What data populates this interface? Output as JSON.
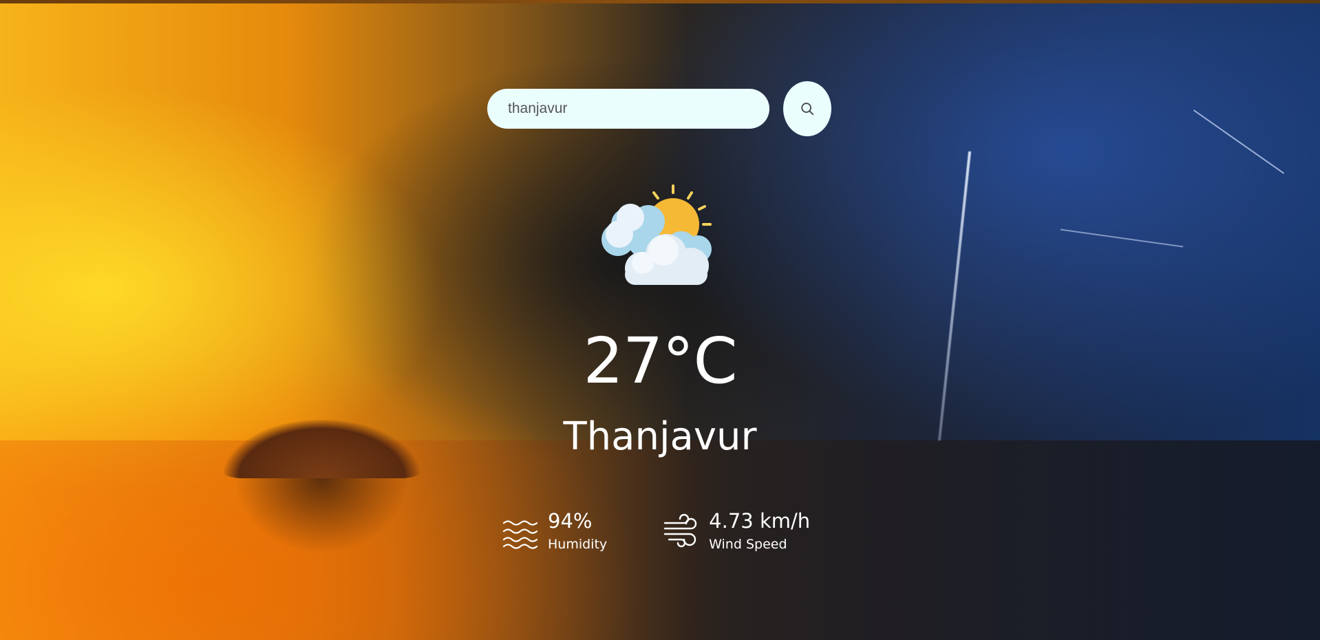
{
  "search": {
    "value": "thanjavur",
    "button_icon": "search-icon"
  },
  "weather": {
    "icon": "partly-cloudy-sun-icon",
    "temperature": "27°C",
    "city": "Thanjavur"
  },
  "details": {
    "humidity": {
      "icon": "humidity-waves-icon",
      "value": "94%",
      "label": "Humidity"
    },
    "wind": {
      "icon": "wind-icon",
      "value": "4.73 km/h",
      "label": "Wind Speed"
    }
  },
  "colors": {
    "input_bg": "#ebfefe",
    "text": "#ffffff",
    "sun": "#f6b936",
    "cloud": "#eaf3fb",
    "cloud_shade": "#a9d6ea"
  }
}
